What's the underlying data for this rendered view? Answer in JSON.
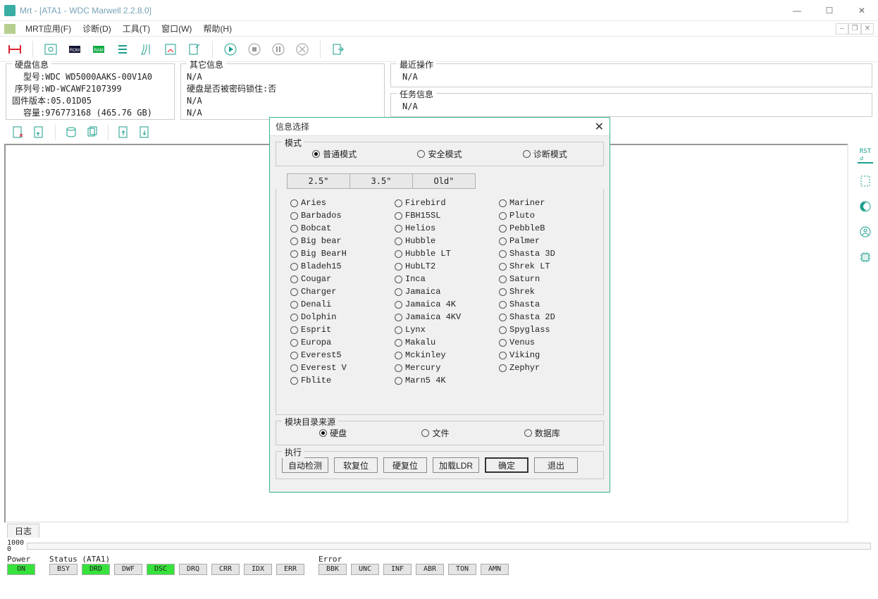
{
  "window": {
    "title": "Mrt - [ATA1 - WDC Marwell 2.2.8.0]"
  },
  "menu": {
    "items": [
      "MRT应用(F)",
      "诊断(D)",
      "工具(T)",
      "窗口(W)",
      "帮助(H)"
    ]
  },
  "panels": {
    "disk": {
      "legend": "硬盘信息",
      "model_lbl": "型号:",
      "model": "WDC WD5000AAKS-00V1A0",
      "serial_lbl": "序列号:",
      "serial": "WD-WCAWF2107399",
      "fw_lbl": "固件版本:",
      "fw": "05.01D05",
      "cap_lbl": "容量:",
      "cap": "976773168 (465.76 GB)"
    },
    "other": {
      "legend": "其它信息",
      "l1": "N/A",
      "l2_lbl": "硬盘是否被密码锁住:",
      "l2_val": "否",
      "l3": "N/A",
      "l4": "N/A"
    },
    "recent": {
      "legend": "最近操作",
      "val": "N/A"
    },
    "task": {
      "legend": "任务信息",
      "val": "N/A"
    }
  },
  "dialog": {
    "title": "信息选择",
    "mode_legend": "模式",
    "modes": [
      "普通模式",
      "安全模式",
      "诊断模式"
    ],
    "tabs": [
      "2.5\"",
      "3.5\"",
      "Old\""
    ],
    "col1": [
      "Aries",
      "Barbados",
      "Bobcat",
      "Big bear",
      "Big BearH",
      "Bladeh15",
      "Cougar",
      "Charger",
      "Denali",
      "Dolphin",
      "Esprit",
      "Europa",
      "Everest5",
      "Everest V",
      "Fblite"
    ],
    "col2": [
      "Firebird",
      "FBH15SL",
      "Helios",
      "Hubble",
      "Hubble LT",
      "HubLT2",
      "Inca",
      "Jamaica",
      "Jamaica 4K",
      "Jamaica 4KV",
      "Lynx",
      "Makalu",
      "Mckinley",
      "Mercury",
      "Marn5 4K"
    ],
    "col3": [
      "Mariner",
      "Pluto",
      "PebbleB",
      "Palmer",
      "Shasta 3D",
      "Shrek LT",
      "Saturn",
      "Shrek",
      "Shasta",
      "Shasta 2D",
      "Spyglass",
      "Venus",
      "Viking",
      "Zephyr"
    ],
    "source_legend": "模块目录来源",
    "sources": [
      "硬盘",
      "文件",
      "数据库"
    ],
    "exec_legend": "执行",
    "buttons": [
      "自动检测",
      "软复位",
      "硬复位",
      "加载LDR",
      "确定",
      "退出"
    ]
  },
  "logtab": "日志",
  "scale": {
    "top": "1000",
    "bot": "0"
  },
  "status": {
    "power_lbl": "Power",
    "power": "ON",
    "status_lbl": "Status (ATA1)",
    "status_cells": [
      "BSY",
      "DRD",
      "DWF",
      "DSC",
      "DRQ",
      "CRR",
      "IDX",
      "ERR"
    ],
    "status_on": [
      false,
      true,
      false,
      true,
      false,
      false,
      false,
      false
    ],
    "error_lbl": "Error",
    "error_cells": [
      "BBK",
      "UNC",
      "INF",
      "ABR",
      "TON",
      "AMN"
    ]
  },
  "rightbar": {
    "rst": "RST"
  }
}
